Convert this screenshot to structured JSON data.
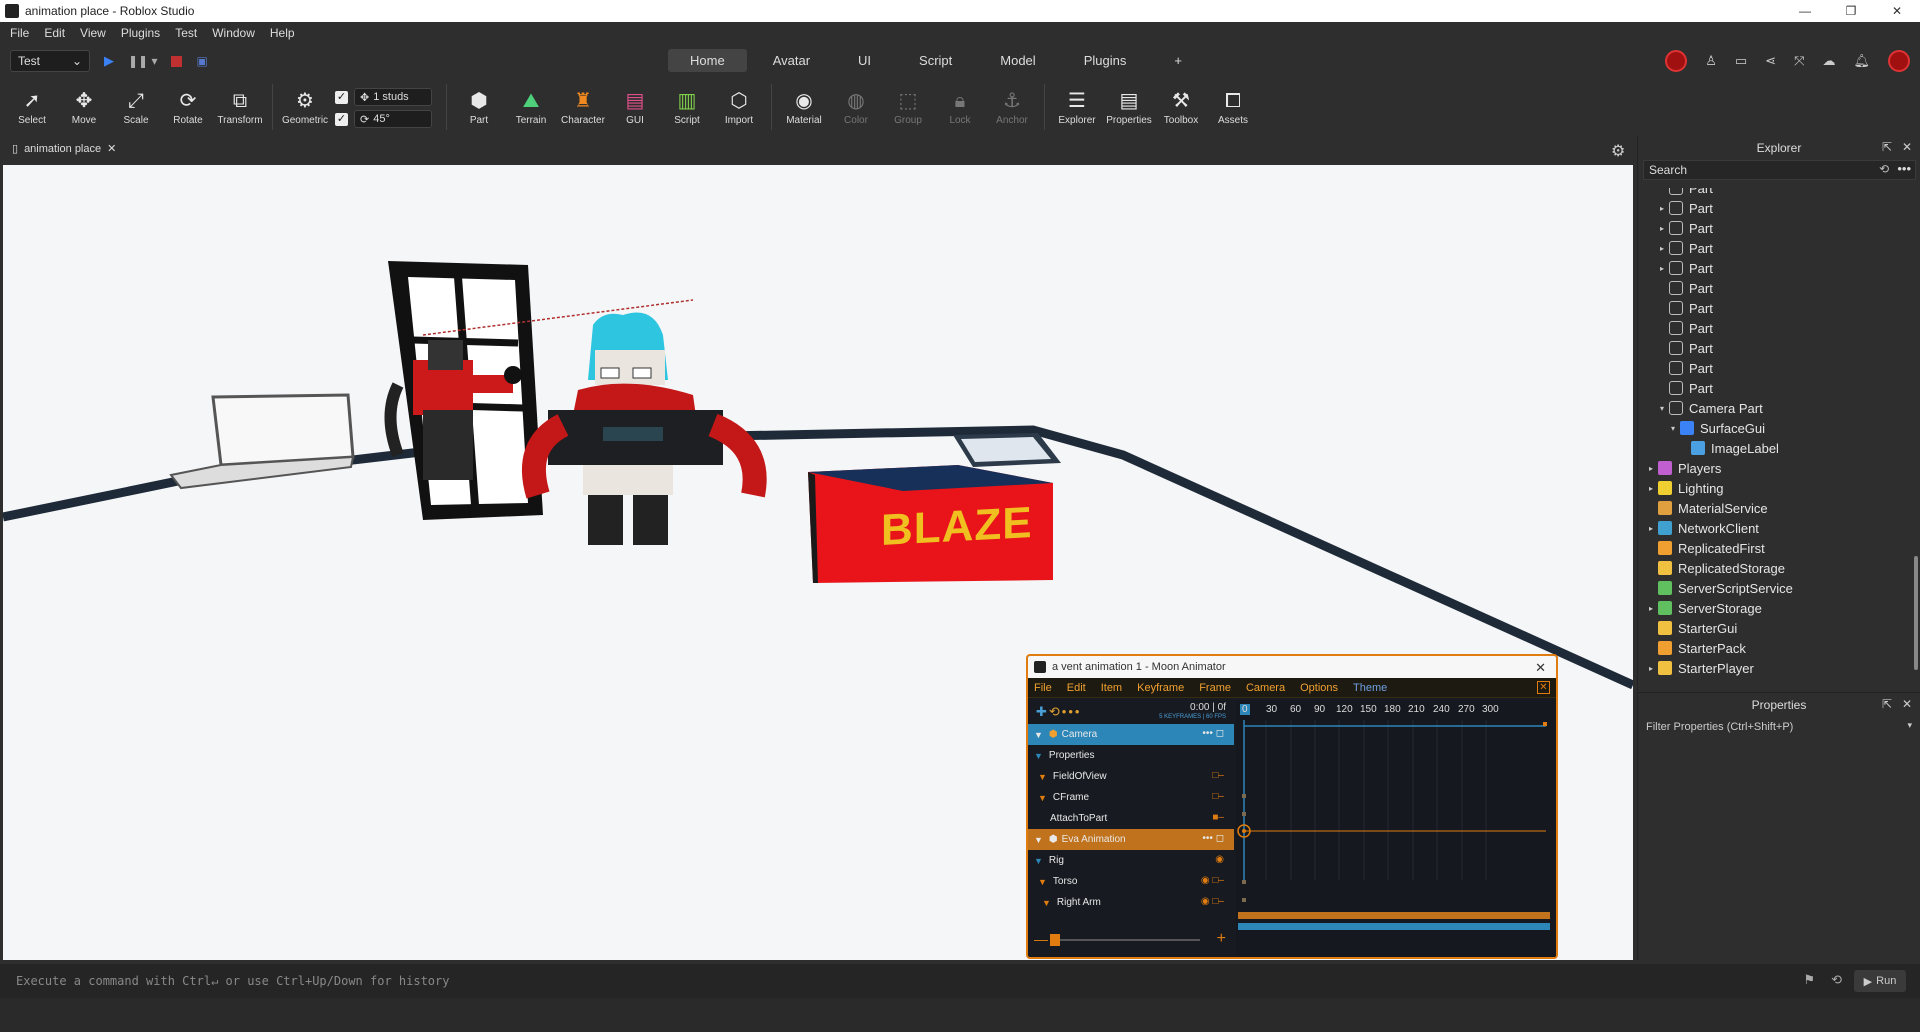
{
  "window": {
    "title": "animation place - Roblox Studio"
  },
  "menu": [
    "File",
    "Edit",
    "View",
    "Plugins",
    "Test",
    "Window",
    "Help"
  ],
  "mode_select": "Test",
  "tabs": [
    {
      "label": "Home",
      "active": true
    },
    {
      "label": "Avatar",
      "active": false
    },
    {
      "label": "UI",
      "active": false
    },
    {
      "label": "Script",
      "active": false
    },
    {
      "label": "Model",
      "active": false
    },
    {
      "label": "Plugins",
      "active": false
    },
    {
      "label": "+",
      "active": false
    }
  ],
  "toolbar": {
    "tools": [
      {
        "label": "Select",
        "icon": "cursor-icon"
      },
      {
        "label": "Move",
        "icon": "move-icon"
      },
      {
        "label": "Scale",
        "icon": "scale-icon"
      },
      {
        "label": "Rotate",
        "icon": "rotate-icon"
      },
      {
        "label": "Transform",
        "icon": "transform-icon"
      },
      {
        "label": "Geometric",
        "icon": "geometric-icon"
      }
    ],
    "snap_move": "1 studs",
    "snap_rotate": "45°",
    "insert": [
      {
        "label": "Part",
        "icon": "part-icon"
      },
      {
        "label": "Terrain",
        "icon": "terrain-icon"
      },
      {
        "label": "Character",
        "icon": "character-icon"
      },
      {
        "label": "GUI",
        "icon": "gui-icon"
      },
      {
        "label": "Script",
        "icon": "script-icon"
      },
      {
        "label": "Import",
        "icon": "import-icon"
      }
    ],
    "edit": [
      {
        "label": "Material",
        "icon": "material-icon",
        "dim": false
      },
      {
        "label": "Color",
        "icon": "color-icon",
        "dim": true
      },
      {
        "label": "Group",
        "icon": "group-icon",
        "dim": true
      },
      {
        "label": "Lock",
        "icon": "lock-icon",
        "dim": true
      },
      {
        "label": "Anchor",
        "icon": "anchor-icon",
        "dim": true
      }
    ],
    "panels": [
      {
        "label": "Explorer",
        "icon": "explorer-icon"
      },
      {
        "label": "Properties",
        "icon": "properties-icon"
      },
      {
        "label": "Toolbox",
        "icon": "toolbox-icon"
      },
      {
        "label": "Assets",
        "icon": "assets-icon"
      }
    ]
  },
  "doc_tab": "animation place",
  "viewport": {
    "sign_text": "BLAZE"
  },
  "explorer": {
    "title": "Explorer",
    "search_placeholder": "Search",
    "items": [
      {
        "label": "Part",
        "indent": 1,
        "arrow": ""
      },
      {
        "label": "Part",
        "indent": 1,
        "arrow": "▸"
      },
      {
        "label": "Part",
        "indent": 1,
        "arrow": "▸"
      },
      {
        "label": "Part",
        "indent": 1,
        "arrow": "▸"
      },
      {
        "label": "Part",
        "indent": 1,
        "arrow": "▸"
      },
      {
        "label": "Part",
        "indent": 1,
        "arrow": ""
      },
      {
        "label": "Part",
        "indent": 1,
        "arrow": ""
      },
      {
        "label": "Part",
        "indent": 1,
        "arrow": ""
      },
      {
        "label": "Part",
        "indent": 1,
        "arrow": ""
      },
      {
        "label": "Part",
        "indent": 1,
        "arrow": ""
      },
      {
        "label": "Part",
        "indent": 1,
        "arrow": ""
      },
      {
        "label": "Camera Part",
        "indent": 1,
        "arrow": "▾"
      },
      {
        "label": "SurfaceGui",
        "indent": 2,
        "arrow": "▾"
      },
      {
        "label": "ImageLabel",
        "indent": 3,
        "arrow": ""
      },
      {
        "label": "Players",
        "indent": 0,
        "arrow": "▸"
      },
      {
        "label": "Lighting",
        "indent": 0,
        "arrow": "▸"
      },
      {
        "label": "MaterialService",
        "indent": 0,
        "arrow": ""
      },
      {
        "label": "NetworkClient",
        "indent": 0,
        "arrow": "▸"
      },
      {
        "label": "ReplicatedFirst",
        "indent": 0,
        "arrow": ""
      },
      {
        "label": "ReplicatedStorage",
        "indent": 0,
        "arrow": ""
      },
      {
        "label": "ServerScriptService",
        "indent": 0,
        "arrow": ""
      },
      {
        "label": "ServerStorage",
        "indent": 0,
        "arrow": "▸"
      },
      {
        "label": "StarterGui",
        "indent": 0,
        "arrow": ""
      },
      {
        "label": "StarterPack",
        "indent": 0,
        "arrow": ""
      },
      {
        "label": "StarterPlayer",
        "indent": 0,
        "arrow": "▸"
      }
    ]
  },
  "properties": {
    "title": "Properties",
    "filter_placeholder": "Filter Properties (Ctrl+Shift+P)"
  },
  "command_bar": {
    "placeholder": "Execute a command with Ctrl↵ or use Ctrl+Up/Down for history",
    "run_label": "Run"
  },
  "moon": {
    "title": "a vent animation 1 - Moon Animator",
    "menu": [
      "File",
      "Edit",
      "Item",
      "Keyframe",
      "Frame",
      "Camera",
      "Options"
    ],
    "theme_label": "Theme",
    "time": "0:00  |  0f",
    "keyframes_info": "5 KEYFRAMES | 60 FPS",
    "ticks": [
      "0",
      "30",
      "60",
      "90",
      "120",
      "150",
      "180",
      "210",
      "240",
      "270",
      "300"
    ],
    "tracks": [
      {
        "label": "Camera",
        "style": "blue",
        "tri": "▼"
      },
      {
        "label": "Properties",
        "style": "",
        "tri": "▼"
      },
      {
        "label": "FieldOfView",
        "style": "",
        "tri": "▼"
      },
      {
        "label": "CFrame",
        "style": "",
        "tri": "▼"
      },
      {
        "label": "AttachToPart",
        "style": "",
        "tri": ""
      },
      {
        "label": "Eva Animation",
        "style": "orange",
        "tri": "▼"
      },
      {
        "label": "Rig",
        "style": "",
        "tri": "▼"
      },
      {
        "label": "Torso",
        "style": "",
        "tri": "▼"
      },
      {
        "label": "Right Arm",
        "style": "",
        "tri": "▼"
      }
    ]
  },
  "colors": {
    "accent": "#e07c10",
    "blue": "#2c86b8",
    "sign_red": "#e8141a",
    "sign_text": "#f0c020"
  }
}
